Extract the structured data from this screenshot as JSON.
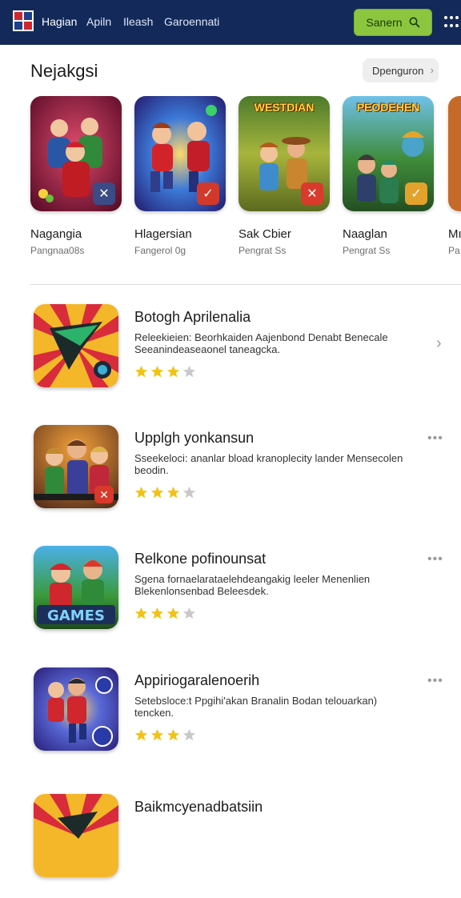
{
  "header": {
    "nav": [
      "Hagian",
      "Apiln",
      "Ileash",
      "Garoennati"
    ],
    "search_label": "Sanern",
    "brand_color": "#12295a",
    "search_color": "#8cc63f"
  },
  "featured": {
    "title": "Nejakgsi",
    "more_label": "Dpenguron",
    "items": [
      {
        "name": "Nagangia",
        "sub": "Pangnaa08s",
        "banner": ""
      },
      {
        "name": "Hlagersian",
        "sub": "Fangerol 0g",
        "banner": ""
      },
      {
        "name": "Sak Cbier",
        "sub": "Pengrat Ss",
        "banner": "WESTDIAN"
      },
      {
        "name": "Naaglan",
        "sub": "Pengrat Ss",
        "banner": "PEODEHEN"
      },
      {
        "name": "Mı",
        "sub": "Pa",
        "banner": ""
      }
    ]
  },
  "list": [
    {
      "title": "Botogh Aprilenalia",
      "desc": "Releekieien: Beorhkaiden Aajenbond Denabt Benecale Seeanindeaseaonel taneagcka.",
      "rating": 3,
      "action": "chevron"
    },
    {
      "title": "Upplgh yonkansun",
      "desc": "Sseekeloci: ananlar bload kranoplecity lander Mensecolen beodin.",
      "rating": 3,
      "action": "more"
    },
    {
      "title": "Relkone pofinounsat",
      "desc": "Sgena fornaelarataelehdeangakig leeler Menenlien Blekenlonsenbad Beleesdek.",
      "rating": 3,
      "action": "more"
    },
    {
      "title": "Appiriogaralenoerih",
      "desc": "Setebsloce:t Ppgihi'akan Branalin Bodan telouarkan) tencken.",
      "rating": 3,
      "action": "more"
    },
    {
      "title": "Baikmcyenadbatsiin",
      "desc": "",
      "rating": 0,
      "action": "none"
    }
  ],
  "glyphs": {
    "more": "•••",
    "chevron": "›"
  },
  "icon_text": {
    "games_logo": "GAMES"
  }
}
